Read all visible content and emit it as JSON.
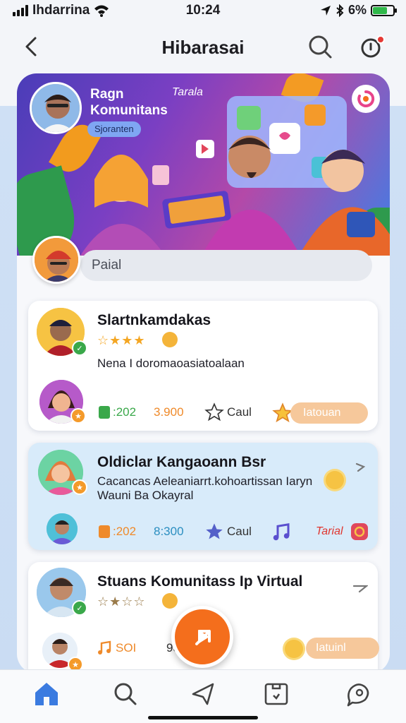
{
  "status_bar": {
    "carrier": "Ihdarrina",
    "time": "10:24",
    "battery": "6%"
  },
  "nav": {
    "title": "Hibarasai"
  },
  "banner": {
    "name": "Ragn Komunitans",
    "tag": "Sjoranten",
    "top_label": "Tarala"
  },
  "profile": {
    "name_field": "Paial"
  },
  "cards": [
    {
      "title": "Slartnkamdakas",
      "stars": "☆★★★",
      "subtitle": "Nena I doromaoasiatoalaan",
      "stat1": ":202",
      "stat2": "3.900",
      "action": "Caul",
      "button": "Iatouan"
    },
    {
      "title": "Oldiclar Kangaoann Bsr",
      "subtitle_line1": "Cacancas Aeleaniarrt.kohoartissan Iaryn",
      "subtitle_line2": "Wauni Ba Okayral",
      "stat1": ":202",
      "stat2": "8:300",
      "action": "Caul",
      "button": "Tarial"
    },
    {
      "title": "Stuans Komunitass Ip Virtual",
      "stars": "☆★☆☆",
      "stat1": "SOI",
      "stat2": "93",
      "button": "Iatuinl"
    }
  ],
  "colors": {
    "accent_orange": "#f46e1c",
    "tab_active": "#3b7be0",
    "stat_green": "#3aa84a",
    "stat_orange": "#ef8a2a"
  }
}
